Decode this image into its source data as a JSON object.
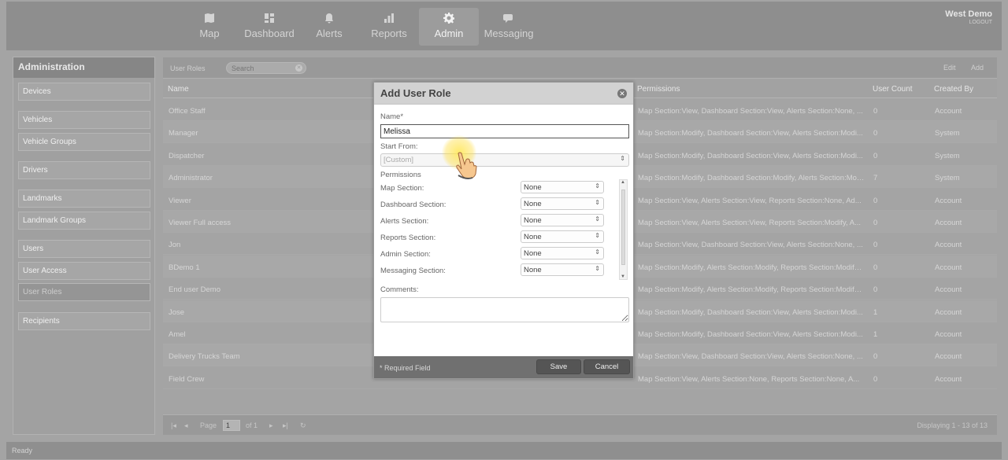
{
  "nav": {
    "items": [
      {
        "label": "Map",
        "icon": "map-icon"
      },
      {
        "label": "Dashboard",
        "icon": "dashboard-icon"
      },
      {
        "label": "Alerts",
        "icon": "bell-icon"
      },
      {
        "label": "Reports",
        "icon": "bar-chart-icon"
      },
      {
        "label": "Admin",
        "icon": "gear-icon"
      },
      {
        "label": "Messaging",
        "icon": "chat-icon"
      }
    ],
    "active": "Admin"
  },
  "account": {
    "name": "West Demo",
    "logout": "LOGOUT"
  },
  "sidebar": {
    "title": "Administration",
    "items": [
      {
        "label": "Devices"
      },
      {
        "label": "Vehicles"
      },
      {
        "label": "Vehicle Groups"
      },
      {
        "label": "Drivers"
      },
      {
        "label": "Landmarks"
      },
      {
        "label": "Landmark Groups"
      },
      {
        "label": "Users"
      },
      {
        "label": "User Access"
      },
      {
        "label": "User Roles"
      },
      {
        "label": "Recipients"
      }
    ],
    "active": "User Roles"
  },
  "toolbar": {
    "title": "User Roles",
    "search_placeholder": "Search",
    "edit": "Edit",
    "add": "Add"
  },
  "grid": {
    "columns": {
      "name": "Name",
      "permissions": "Permissions",
      "user_count": "User Count",
      "created_by": "Created By"
    },
    "rows": [
      {
        "name": "Office Staff",
        "permissions": "Map Section:View, Dashboard Section:View, Alerts Section:None, ...",
        "user_count": "0",
        "created_by": "Account"
      },
      {
        "name": "Manager",
        "permissions": "Map Section:Modify, Dashboard Section:View, Alerts Section:Modi...",
        "user_count": "0",
        "created_by": "System"
      },
      {
        "name": "Dispatcher",
        "permissions": "Map Section:Modify, Dashboard Section:View, Alerts Section:Modi...",
        "user_count": "0",
        "created_by": "System"
      },
      {
        "name": "Administrator",
        "permissions": "Map Section:Modify, Dashboard Section:Modify, Alerts Section:Modi...",
        "user_count": "7",
        "created_by": "System"
      },
      {
        "name": "Viewer",
        "permissions": "Map Section:View, Alerts Section:View, Reports Section:None, Ad...",
        "user_count": "0",
        "created_by": "Account"
      },
      {
        "name": "Viewer Full access",
        "permissions": "Map Section:View, Alerts Section:View, Reports Section:Modify, A...",
        "user_count": "0",
        "created_by": "Account"
      },
      {
        "name": "Jon",
        "permissions": "Map Section:View, Dashboard Section:View, Alerts Section:None, ...",
        "user_count": "0",
        "created_by": "Account"
      },
      {
        "name": "BDemo 1",
        "permissions": "Map Section:Modify, Alerts Section:Modify, Reports Section:Modify, ...",
        "user_count": "0",
        "created_by": "Account"
      },
      {
        "name": "End user Demo",
        "permissions": "Map Section:Modify, Alerts Section:Modify, Reports Section:Modify, ...",
        "user_count": "0",
        "created_by": "Account"
      },
      {
        "name": "Jose",
        "permissions": "Map Section:Modify, Dashboard Section:View, Alerts Section:Modi...",
        "user_count": "1",
        "created_by": "Account"
      },
      {
        "name": "Amel",
        "permissions": "Map Section:Modify, Dashboard Section:View, Alerts Section:Modi...",
        "user_count": "1",
        "created_by": "Account"
      },
      {
        "name": "Delivery Trucks Team",
        "permissions": "Map Section:View, Dashboard Section:View, Alerts Section:None, ...",
        "user_count": "0",
        "created_by": "Account"
      },
      {
        "name": "Field Crew",
        "permissions": "Map Section:View, Alerts Section:None, Reports Section:None, A...",
        "user_count": "0",
        "created_by": "Account"
      }
    ]
  },
  "pager": {
    "page_label": "Page",
    "page_value": "1",
    "of_label": "of 1",
    "display_text": "Displaying 1 - 13 of 13"
  },
  "status": "Ready",
  "dialog": {
    "title": "Add User Role",
    "name_label": "Name*",
    "name_value": "Melissa",
    "start_from_label": "Start From:",
    "start_from_value": "[Custom]",
    "permissions_label": "Permissions",
    "permissions": [
      {
        "label": "Map Section:",
        "value": "None"
      },
      {
        "label": "Dashboard Section:",
        "value": "None"
      },
      {
        "label": "Alerts Section:",
        "value": "None"
      },
      {
        "label": "Reports Section:",
        "value": "None"
      },
      {
        "label": "Admin Section:",
        "value": "None"
      },
      {
        "label": "Messaging Section:",
        "value": "None"
      }
    ],
    "comments_label": "Comments:",
    "required_note": "* Required Field",
    "save": "Save",
    "cancel": "Cancel"
  }
}
